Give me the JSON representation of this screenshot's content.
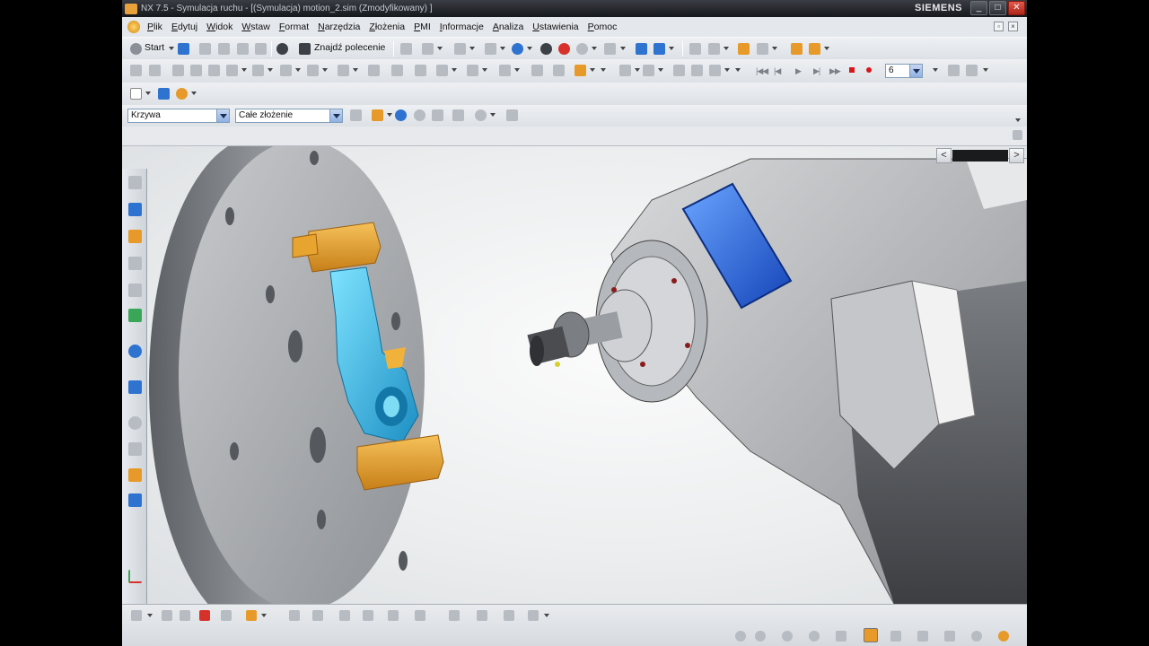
{
  "window": {
    "title": "NX 7.5 - Symulacja ruchu - [(Symulacja) motion_2.sim (Zmodyfikowany) ]",
    "brand": "SIEMENS",
    "buttons": {
      "minimize": "_",
      "maximize": "□",
      "close": "✕"
    }
  },
  "menu": {
    "items": [
      "Plik",
      "Edytuj",
      "Widok",
      "Wstaw",
      "Format",
      "Narzędzia",
      "Złożenia",
      "PMI",
      "Informacje",
      "Analiza",
      "Ustawienia",
      "Pomoc"
    ]
  },
  "toolbar": {
    "start_label": "Start",
    "find_command_label": "Znajdź polecenie",
    "animation_step_value": "6"
  },
  "selection_bar": {
    "filter_value": "Krzywa",
    "scope_value": "Całe złożenie"
  },
  "viewport": {
    "nav_left": "<",
    "nav_right": ">"
  },
  "colors": {
    "titlebar": "#1d1f23",
    "fixture_gold": "#e8a33a",
    "part_cyan": "#2ab4e0",
    "window_blue": "#1d5fd8",
    "close_red": "#c8372a"
  },
  "icons": {
    "start": "start-gear-icon",
    "save": "save-icon",
    "undo": "undo-icon",
    "stop": "stop-icon",
    "record": "record-icon"
  }
}
